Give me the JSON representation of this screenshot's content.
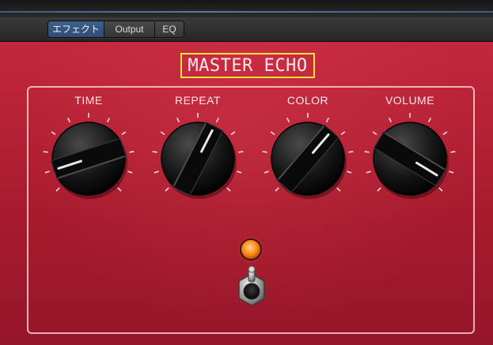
{
  "tabs": [
    {
      "label": "エフェクト",
      "active": true
    },
    {
      "label": "Output",
      "active": false
    },
    {
      "label": "EQ",
      "active": false
    }
  ],
  "pedal": {
    "title": "MASTER ECHO",
    "knobs": [
      {
        "label": "TIME",
        "value": 0.1
      },
      {
        "label": "REPEAT",
        "value": 0.6
      },
      {
        "label": "COLOR",
        "value": 0.65
      },
      {
        "label": "VOLUME",
        "value": 0.95
      }
    ],
    "led_on": true
  },
  "colors": {
    "pedal_red": "#b01f33",
    "highlight": "#f2e33c",
    "active_tab": "#3d5f8b",
    "led": "#ff8a1a"
  }
}
